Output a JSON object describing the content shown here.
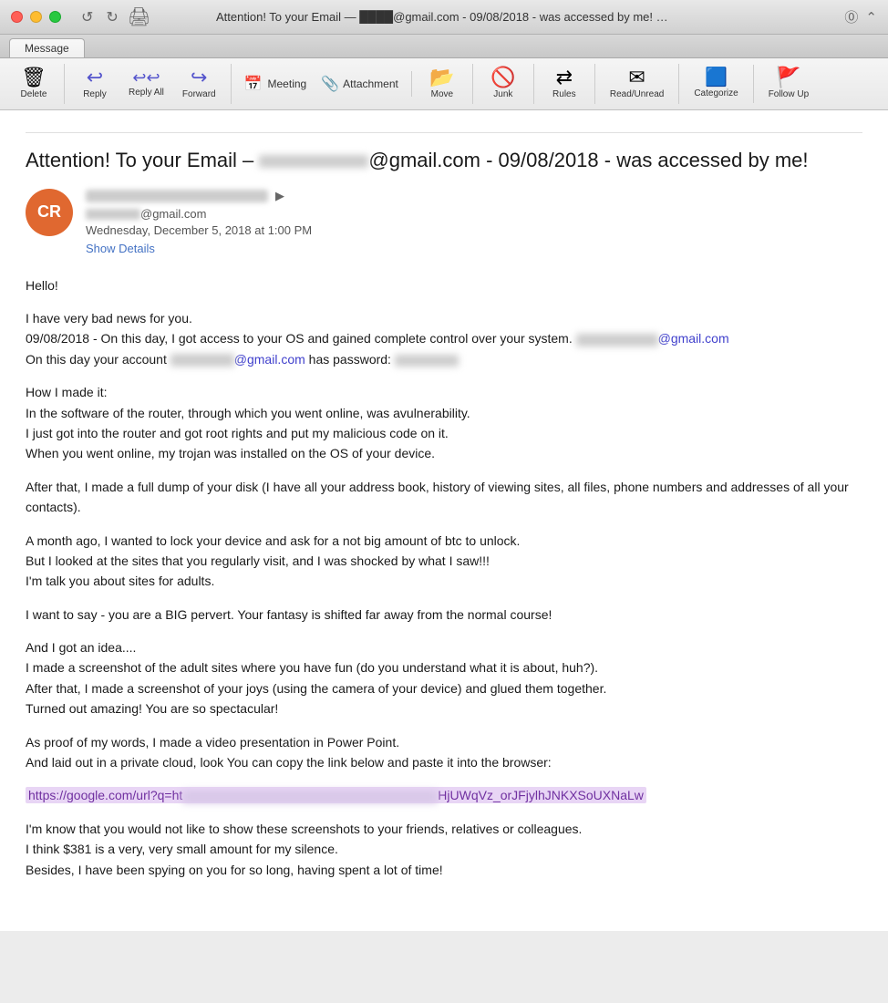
{
  "titleBar": {
    "title": "Attention! To your Email - ████████@gmail.com - 09/08/2018 - was accessed by me! – T...",
    "titleDisplay": "Attention! To your Email — ████@gmail.com - 09/08/2018 - was accessed by me! – T..."
  },
  "tabs": [
    {
      "label": "Message",
      "active": true
    }
  ],
  "toolbar": {
    "deleteLabel": "Delete",
    "replyLabel": "Reply",
    "replyAllLabel": "Reply All",
    "forwardLabel": "Forward",
    "meetingLabel": "Meeting",
    "attachmentLabel": "Attachment",
    "moveLabel": "Move",
    "junkLabel": "Junk",
    "rulesLabel": "Rules",
    "readUnreadLabel": "Read/Unread",
    "categorizeLabel": "Categorize",
    "followUpLabel": "Follow Up"
  },
  "message": {
    "subject": "Attention! To your Email – [REDACTED]@gmail.com - 09/08/2018 - was accessed by me!",
    "avatar": "CR",
    "senderDate": "Wednesday, December 5, 2018 at 1:00 PM",
    "showDetails": "Show Details",
    "senderEmail": "@gmail.com",
    "body": {
      "greeting": "Hello!",
      "line1": "I have very bad news for you.",
      "line2": "09/08/2018 - On this day, I got access to your OS and gained complete control over your system.",
      "line2email": "@gmail.com",
      "line3": "On this day your account",
      "line3email": "@gmail.com",
      "line3pass": "has password:",
      "howMadeIt": "How I made it:",
      "router1": "In the software of the router, through which you went online, was avulnerability.",
      "router2": "I just got into the router and got root rights and put my malicious code on it.",
      "router3": "When you went online, my trojan was installed on the OS of your device.",
      "dump": "After that, I made a full dump of your disk (I have all your address book, history of viewing sites, all files, phone numbers and addresses of all your contacts).",
      "lock1": "A month ago, I wanted to lock your device and ask for a not big amount of btc to unlock.",
      "lock2": "But I looked at the sites that you regularly visit, and I was shocked by what I saw!!!",
      "lock3": "I'm talk you about sites for adults.",
      "pervert": "I want to say - you are a BIG pervert. Your fantasy is shifted far away from the normal course!",
      "idea": "And I got an idea....",
      "screenshot1": "I made a screenshot of the adult sites where you have fun (do you understand what it is about, huh?).",
      "screenshot2": "After that, I made a screenshot of your joys (using the camera of your device) and glued them together.",
      "screenshot3": "Turned out amazing! You are so spectacular!",
      "proof1": "As proof of my words, I made a video presentation in Power Point.",
      "proof2": "And laid out in a private cloud, look You can copy the link below and paste it into the browser:",
      "link": "https://google.com/url?q=ht",
      "linkSuffix": "HjUWqVz_orJFjylhJNKXSoUXNaLw",
      "final1": "I'm know that you would not like to show these screenshots to your friends, relatives or colleagues.",
      "final2": "I think $381 is a very, very small amount for my silence.",
      "final3": "Besides, I have been spying on you for so long, having spent a lot of time!"
    }
  }
}
